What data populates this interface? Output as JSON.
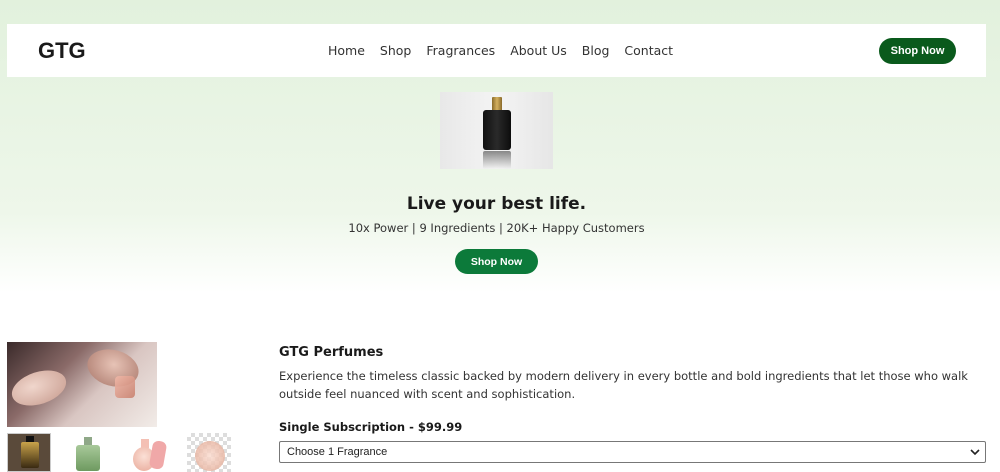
{
  "brand": {
    "logo": "GTG"
  },
  "nav": {
    "links": [
      "Home",
      "Shop",
      "Fragrances",
      "About Us",
      "Blog",
      "Contact"
    ],
    "cta": "Shop Now"
  },
  "hero": {
    "title": "Live your best life.",
    "subtitle": "10x Power | 9 Ingredients | 20K+ Happy Customers",
    "cta": "Shop Now"
  },
  "product": {
    "title": "GTG Perfumes",
    "description": "Experience the timeless classic backed by modern delivery in every bottle and bold ingredients that let those who walk outside feel nuanced with scent and sophistication.",
    "subscription_label": "Single Subscription - $99.99",
    "select_value": "Choose 1 Fragrance"
  },
  "colors": {
    "nav_button": "#0a5a1c",
    "hero_button": "#0c7a3a",
    "background_top": "#e2f1dd"
  }
}
